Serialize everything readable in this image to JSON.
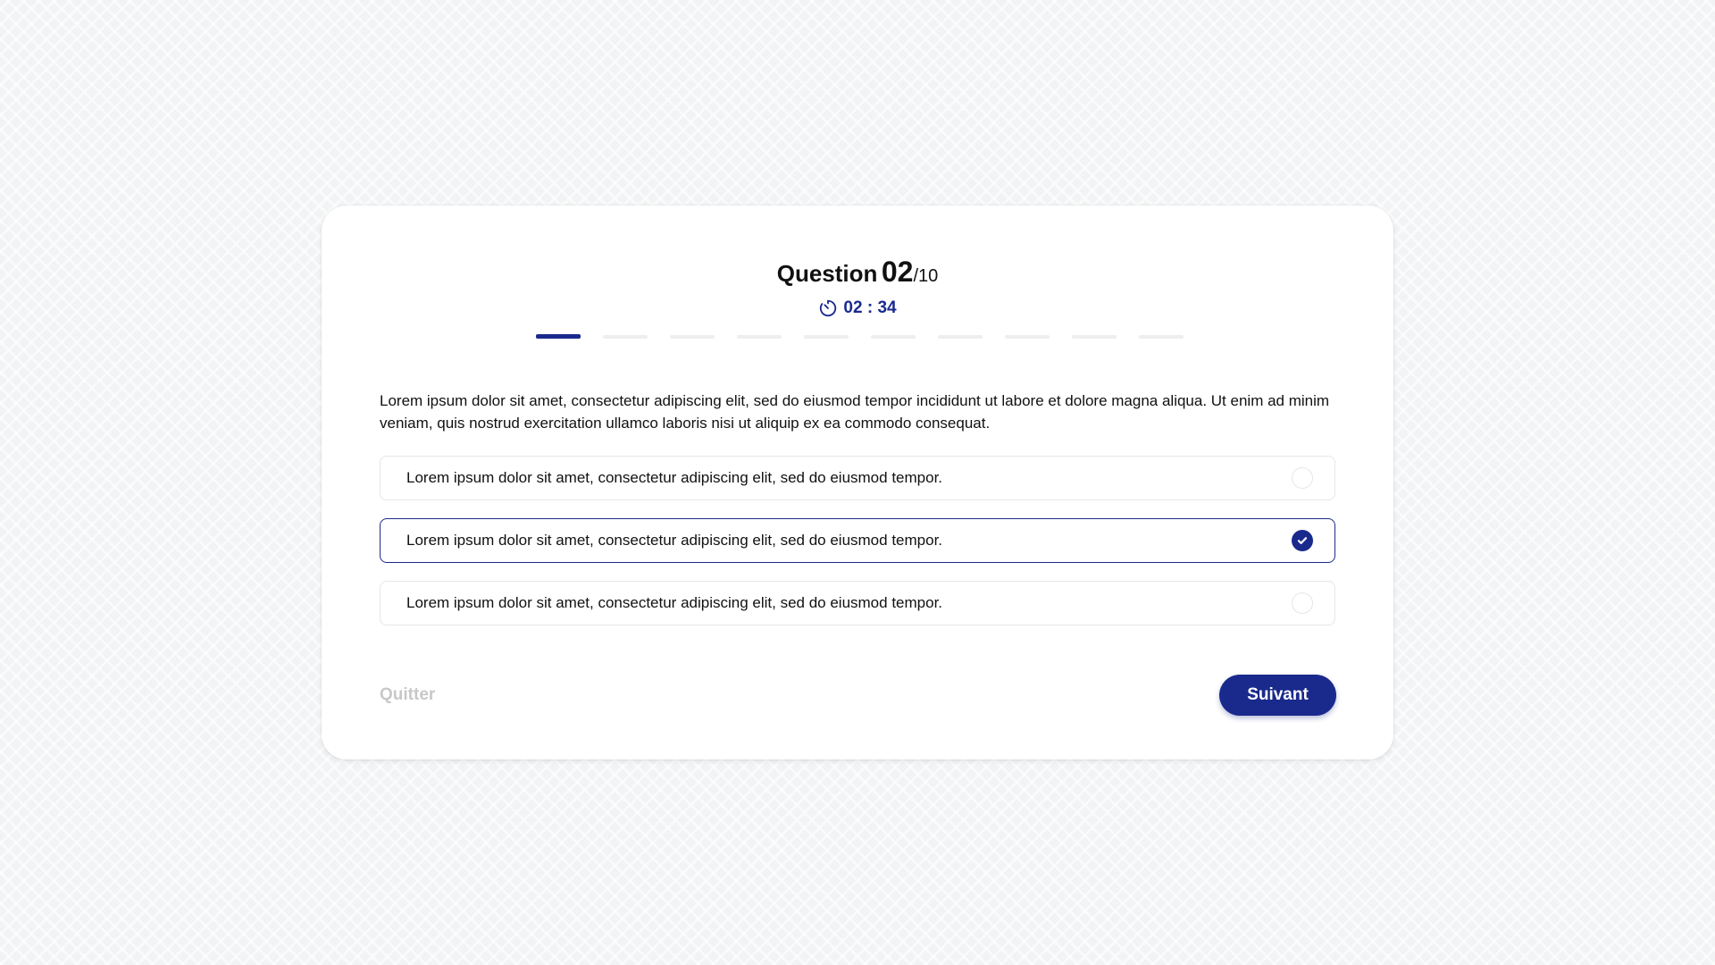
{
  "header": {
    "question_label": "Question",
    "question_number": "02",
    "question_total": "/10"
  },
  "timer": {
    "icon": "stopwatch-icon",
    "value": "02 : 34"
  },
  "progress": {
    "current": 1,
    "total": 10
  },
  "question": {
    "text": "Lorem ipsum dolor sit amet, consectetur adipiscing elit, sed do eiusmod tempor incididunt ut labore et dolore magna aliqua. Ut enim ad minim veniam, quis nostrud exercitation ullamco laboris nisi ut aliquip ex ea commodo consequat."
  },
  "options": [
    {
      "text": "Lorem ipsum dolor sit amet, consectetur adipiscing elit, sed do eiusmod tempor.",
      "selected": false
    },
    {
      "text": "Lorem ipsum dolor sit amet, consectetur adipiscing elit, sed do eiusmod tempor.",
      "selected": true
    },
    {
      "text": "Lorem ipsum dolor sit amet, consectetur adipiscing elit, sed do eiusmod tempor.",
      "selected": false
    }
  ],
  "actions": {
    "quit_label": "Quitter",
    "next_label": "Suivant"
  },
  "colors": {
    "accent": "#1a2a8c",
    "muted": "#c8c8c8",
    "track": "#eeeeee"
  }
}
